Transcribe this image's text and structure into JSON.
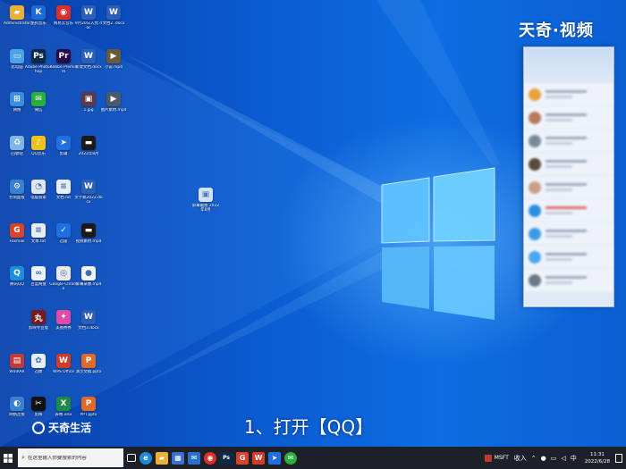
{
  "watermark": {
    "top_right": "天奇·视频",
    "bottom_left": "天奇生活"
  },
  "subtitle": "1、打开【QQ】",
  "desktop_icons": [
    {
      "id": "d1",
      "label": "Administrator",
      "color": "#e8b23a",
      "glyph": "▰"
    },
    {
      "id": "d2",
      "label": "酷狗音乐",
      "color": "#1a6bd8",
      "glyph": "K"
    },
    {
      "id": "d3",
      "label": "网易云音乐",
      "color": "#d9302b",
      "glyph": "◉"
    },
    {
      "id": "d4",
      "label": "9月20日入党.doc",
      "color": "#2b5fb8",
      "glyph": "W"
    },
    {
      "id": "d5",
      "label": "文档2 .docx",
      "color": "#2b5fb8",
      "glyph": "W"
    },
    {
      "id": "d6",
      "label": "此电脑",
      "color": "#4aa3e8",
      "glyph": "▭"
    },
    {
      "id": "d7",
      "label": "Adobe Photoshop",
      "color": "#0b2a4a",
      "glyph": "Ps"
    },
    {
      "id": "d8",
      "label": "Adobe Premiere",
      "color": "#2a0b4a",
      "glyph": "Pr"
    },
    {
      "id": "d9",
      "label": "新建文档.docx",
      "color": "#2b5fb8",
      "glyph": "W"
    },
    {
      "id": "d10",
      "label": "小说.mp4",
      "color": "#6a5a3a",
      "glyph": "▶"
    },
    {
      "id": "d11",
      "label": "网络",
      "color": "#3a8ee0",
      "glyph": "⊞"
    },
    {
      "id": "d12",
      "label": "微信",
      "color": "#2aae3d",
      "glyph": "✉"
    },
    {
      "id": "d13",
      "label": "1.jpg",
      "color": "#5a3a4a",
      "glyph": "▣"
    },
    {
      "id": "d14",
      "label": "图片素材.mp4",
      "color": "#4a5a6a",
      "glyph": "▶"
    },
    {
      "id": "d15",
      "label": "回收站",
      "color": "#7fb6e6",
      "glyph": "♻"
    },
    {
      "id": "d16",
      "label": "QQ音乐",
      "color": "#f1c21b",
      "glyph": "♪"
    },
    {
      "id": "d17",
      "label": "剪辑",
      "color": "#1f6fe0",
      "glyph": "➤"
    },
    {
      "id": "d18",
      "label": "2022年8月",
      "color": "#1a1a1a",
      "glyph": "▬"
    },
    {
      "id": "d19",
      "label": "控制面板",
      "color": "#3a7fd0",
      "glyph": "⚙"
    },
    {
      "id": "d20",
      "label": "电脑管家",
      "color": "#dfe6ee",
      "glyph": "◔"
    },
    {
      "id": "d21",
      "label": "文档.txt",
      "color": "#e8edf3",
      "glyph": "≡"
    },
    {
      "id": "d22",
      "label": "文字稿2022.docx",
      "color": "#2b5fb8",
      "glyph": "W"
    },
    {
      "id": "d23",
      "label": "Foxmail",
      "color": "#d9432b",
      "glyph": "G"
    },
    {
      "id": "d24",
      "label": "文本.txt",
      "color": "#e8edf3",
      "glyph": "≡"
    },
    {
      "id": "d25",
      "label": "迅雷",
      "color": "#1f6fe0",
      "glyph": "✓"
    },
    {
      "id": "d26",
      "label": "视频素材.mp4",
      "color": "#1a1a1a",
      "glyph": "▬"
    },
    {
      "id": "d27",
      "label": "腾讯QQ",
      "color": "#1a8fe0",
      "glyph": "Q"
    },
    {
      "id": "d28",
      "label": "百度网盘",
      "color": "#eaf3ff",
      "glyph": "∞"
    },
    {
      "id": "d29",
      "label": "Google Chrome",
      "color": "#e9e9e9",
      "glyph": "◎"
    },
    {
      "id": "d30",
      "label": "屏幕录像.mp4",
      "color": "#f3f3f3",
      "glyph": "●"
    },
    {
      "id": "d31",
      "label": "剪映专业版",
      "color": "#7a1a1a",
      "glyph": "丸"
    },
    {
      "id": "d32",
      "label": "美图秀秀",
      "color": "#e04aa8",
      "glyph": "✦"
    },
    {
      "id": "d33",
      "label": "文档3.docx",
      "color": "#2b5fb8",
      "glyph": "W"
    },
    {
      "id": "d34",
      "label": "WinRAR",
      "color": "#c23a3a",
      "glyph": "▤"
    },
    {
      "id": "d35",
      "label": "迅捷",
      "color": "#e8eef6",
      "glyph": "✿"
    },
    {
      "id": "d36",
      "label": "WPS Office",
      "color": "#d23a2a",
      "glyph": "W"
    },
    {
      "id": "d37",
      "label": "演示文稿.pptx",
      "color": "#e06a2a",
      "glyph": "P"
    },
    {
      "id": "d38",
      "label": "网络连接",
      "color": "#3a7fd0",
      "glyph": "◐"
    },
    {
      "id": "d39",
      "label": "剪映",
      "color": "#111111",
      "glyph": "✂"
    },
    {
      "id": "d40",
      "label": "表格.xlsx",
      "color": "#1e8a4a",
      "glyph": "X"
    },
    {
      "id": "d41",
      "label": "PPT.pptx",
      "color": "#e06a2a",
      "glyph": "P"
    }
  ],
  "center_file": {
    "label": "屏幕截图 2022年8月",
    "color": "#cfe2f7",
    "glyph": "▣"
  },
  "taskbar": {
    "search_placeholder": "在这里输入你要搜索的内容",
    "stock": "MSFT",
    "tray_text": "收入",
    "time": "11:31",
    "date": "2022/6/28"
  }
}
